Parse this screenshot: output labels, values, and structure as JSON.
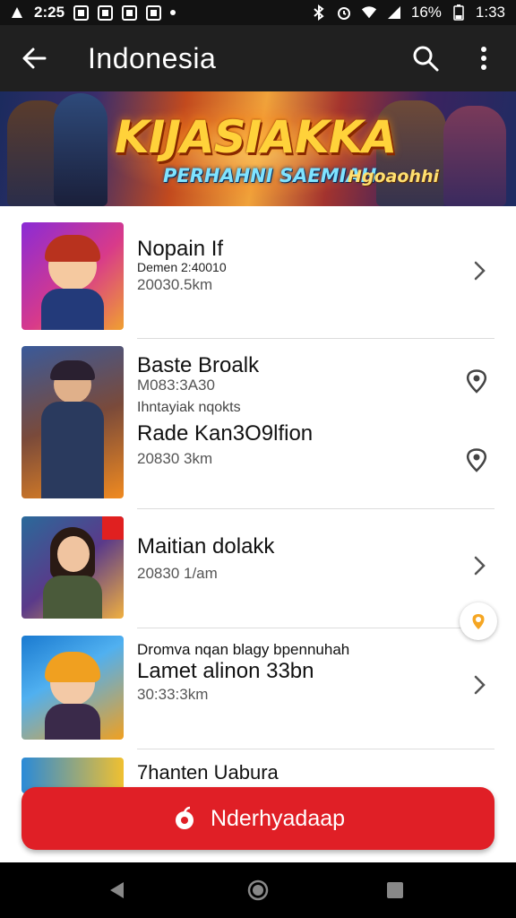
{
  "status_bar": {
    "time_left": "2:25",
    "battery": "16%",
    "time_right": "1:33"
  },
  "app_bar": {
    "title": "Indonesia"
  },
  "banner": {
    "title": "KIJASIAKKA",
    "subtitle": "PERHAHNI SAEMIAH",
    "tag": "Hgoaohhi"
  },
  "items": [
    {
      "title": "Nopain If",
      "lines": [
        "Demen 2:40010",
        "20030.5km"
      ],
      "action": "chevron-right-icon"
    },
    {
      "title": "Baste Broalk",
      "lines": [
        "M083:3A30",
        "Ihntayiak nqokts"
      ],
      "action": "location-pin-icon",
      "title2": "Rade Kan3O9lfion",
      "lines2": [
        "20830 3km"
      ],
      "action2": "location-pin-icon"
    },
    {
      "title": "Maitian dolakk",
      "lines": [
        "20830 1/am"
      ],
      "action": "chevron-right-icon"
    },
    {
      "title": "Lamet alinon 33bn",
      "pre_title": "Dromva nqan blagy  bpennuhah",
      "lines": [
        "30:33:3km"
      ],
      "action": "chevron-right-icon"
    },
    {
      "title": "7hanten Uabura",
      "lines": [],
      "action": ""
    }
  ],
  "cta": {
    "label": "Nderhyadaap"
  },
  "colors": {
    "accent": "#e01f26",
    "app_bar": "#202020",
    "status_bar": "#121212"
  }
}
